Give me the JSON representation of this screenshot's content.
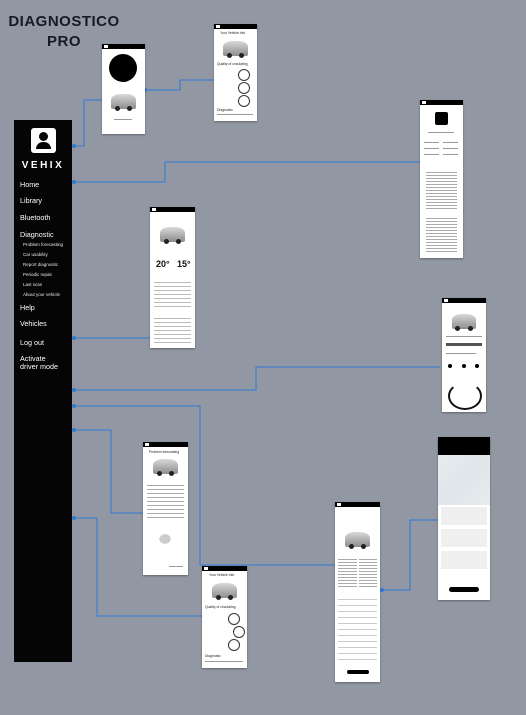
{
  "header": {
    "title_line1": "DIAGNOSTICO",
    "title_line2": "PRO"
  },
  "sidebar": {
    "brand": "VEHIX",
    "items": [
      {
        "label": "Home"
      },
      {
        "label": "Library"
      },
      {
        "label": "Bluetooth"
      },
      {
        "label": "Diagnostic"
      },
      {
        "label": "Problem forecasting"
      },
      {
        "label": "Car usability"
      },
      {
        "label": "Report diagnostic"
      },
      {
        "label": "Periodic repair"
      },
      {
        "label": "Last scan"
      },
      {
        "label": "About your vehicle"
      },
      {
        "label": "Help"
      },
      {
        "label": "Vehicles"
      },
      {
        "label": "Log out"
      },
      {
        "label": "Activate"
      },
      {
        "label": "driver mode"
      }
    ]
  },
  "colors": {
    "background": "#9298a3",
    "sidebar": "#050505",
    "connector": "#2f78d4"
  },
  "screens": {
    "gauges_top": {
      "heading": "Your Vehicle Info",
      "section": "Quality of circulating",
      "label": "Diagnostic"
    },
    "temps": {
      "left": "20°",
      "right": "15°"
    },
    "forecast": {
      "heading": "Problem forecasting"
    },
    "gauges_bottom": {
      "heading": "Your Vehicle Info",
      "section": "Quality of circulating",
      "label": "Diagnostic"
    }
  }
}
